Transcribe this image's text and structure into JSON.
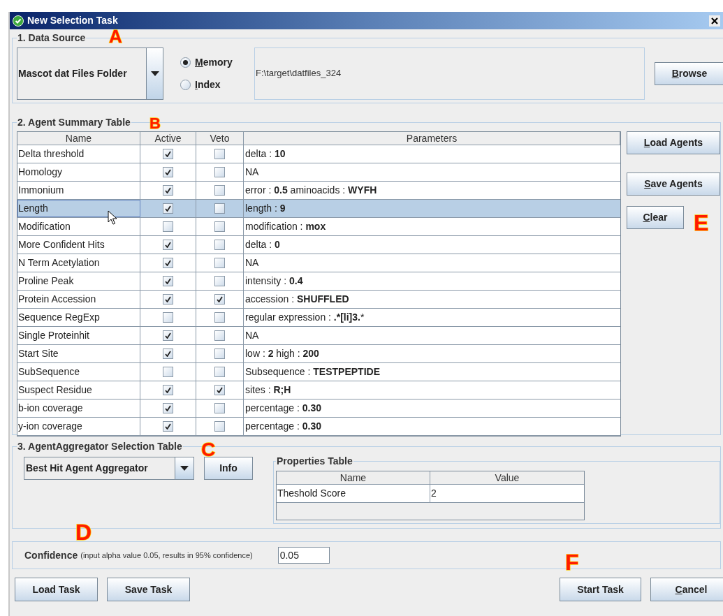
{
  "window": {
    "title": "New Selection Task"
  },
  "data_source": {
    "title": "1. Data Source",
    "callout": "A",
    "source_select": "Mascot dat Files Folder",
    "radios": [
      {
        "label": "Memory",
        "selected": true,
        "underline_first": true
      },
      {
        "label": "Index",
        "selected": false,
        "underline_first": true
      }
    ],
    "path": "F:\\target\\datfiles_324",
    "browse": {
      "label": "Browse",
      "underline_first": true
    }
  },
  "agent_table": {
    "title": "2. Agent Summary Table",
    "callout": "B",
    "columns": [
      "Name",
      "Active",
      "Veto",
      "Parameters"
    ],
    "rows": [
      {
        "name": "Delta threshold",
        "active": true,
        "veto": false,
        "parameters": "delta : **10**",
        "selected": false
      },
      {
        "name": "Homology",
        "active": true,
        "veto": false,
        "parameters": "NA",
        "selected": false
      },
      {
        "name": "Immonium",
        "active": true,
        "veto": false,
        "parameters": "error : **0.5** aminoacids : **WYFH**",
        "selected": false
      },
      {
        "name": "Length",
        "active": true,
        "veto": false,
        "parameters": "length : **9**",
        "selected": true
      },
      {
        "name": "Modification",
        "active": false,
        "veto": false,
        "parameters": "modification : **mox**",
        "selected": false
      },
      {
        "name": "More Confident Hits",
        "active": true,
        "veto": false,
        "parameters": "delta : **0**",
        "selected": false
      },
      {
        "name": "N Term Acetylation",
        "active": true,
        "veto": false,
        "parameters": "NA",
        "selected": false
      },
      {
        "name": "Proline Peak",
        "active": true,
        "veto": false,
        "parameters": "intensity : **0.4**",
        "selected": false
      },
      {
        "name": "Protein Accession",
        "active": true,
        "veto": true,
        "parameters": "accession : **SHUFFLED**",
        "selected": false
      },
      {
        "name": "Sequence RegExp",
        "active": false,
        "veto": false,
        "parameters": "regular expression : **.*[li]3.***",
        "selected": false
      },
      {
        "name": "Single Proteinhit",
        "active": true,
        "veto": false,
        "parameters": "NA",
        "selected": false
      },
      {
        "name": "Start Site",
        "active": true,
        "veto": false,
        "parameters": "low : **2** high : **200**",
        "selected": false
      },
      {
        "name": "SubSequence",
        "active": false,
        "veto": false,
        "parameters": "Subsequence : **TESTPEPTIDE**",
        "selected": false
      },
      {
        "name": "Suspect Residue",
        "active": true,
        "veto": true,
        "parameters": "sites : **R;H**",
        "selected": false
      },
      {
        "name": "b-ion coverage",
        "active": true,
        "veto": false,
        "parameters": "percentage : **0.30**",
        "selected": false
      },
      {
        "name": "y-ion coverage",
        "active": true,
        "veto": false,
        "parameters": "percentage : **0.30**",
        "selected": false
      }
    ],
    "buttons_callout": "E",
    "buttons": [
      {
        "label": "Load Agents",
        "underline_first": true
      },
      {
        "label": "Save Agents",
        "underline_first": true
      },
      {
        "label": "Clear",
        "underline_first": true
      }
    ]
  },
  "aggregator": {
    "title": "3. AgentAggregator Selection Table",
    "callout": "C",
    "select": "Best Hit Agent Aggregator",
    "info_button": "Info",
    "properties": {
      "title": "Properties Table",
      "columns": [
        "Name",
        "Value"
      ],
      "rows": [
        [
          "Theshold Score",
          "2"
        ]
      ]
    }
  },
  "confidence": {
    "callout": "D",
    "label": "Confidence",
    "hint": "(input alpha value 0.05, results in 95% confidence)",
    "value": "0.05"
  },
  "footer": {
    "callout": "F",
    "left_buttons": [
      {
        "label": "Load Task",
        "underline_first": false
      },
      {
        "label": "Save Task",
        "underline_first": false
      }
    ],
    "right_buttons": [
      {
        "label": "Start Task",
        "underline_first": false
      },
      {
        "label": "Cancel",
        "underline_first": true
      }
    ]
  }
}
